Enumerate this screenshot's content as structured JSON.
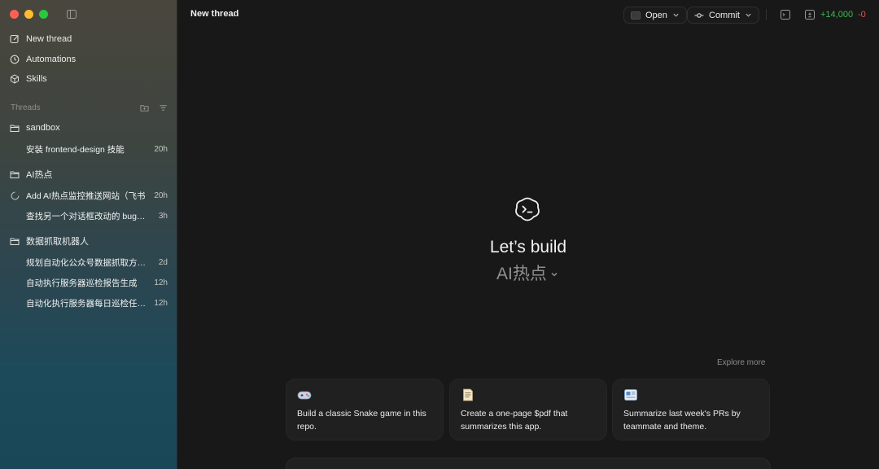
{
  "sidebar": {
    "nav": [
      {
        "label": "New thread",
        "icon": "edit-icon"
      },
      {
        "label": "Automations",
        "icon": "clock-icon"
      },
      {
        "label": "Skills",
        "icon": "cube-icon"
      }
    ],
    "threads_label": "Threads",
    "groups": [
      {
        "folder": "sandbox",
        "threads": [
          {
            "title": "安装 frontend-design 技能",
            "time": "20h"
          }
        ]
      },
      {
        "folder": "AI热点",
        "threads": [
          {
            "title": "Add AI热点监控推送网站（飞书",
            "time": "20h"
          },
          {
            "title": "查找另一个对话框改动的 bug…",
            "time": "3h"
          }
        ]
      },
      {
        "folder": "数据抓取机器人",
        "threads": [
          {
            "title": "规划自动化公众号数据抓取方…",
            "time": "2d"
          },
          {
            "title": "自动执行服务器巡检报告生成",
            "time": "12h"
          },
          {
            "title": "自动化执行服务器每日巡检任…",
            "time": "12h"
          }
        ]
      }
    ]
  },
  "header": {
    "title": "New thread",
    "open_label": "Open",
    "commit_label": "Commit",
    "diff_added": "+14,000",
    "diff_removed": "-0"
  },
  "hero": {
    "title": "Let’s build",
    "project": "AI热点"
  },
  "explore_more": "Explore more",
  "suggestions": [
    {
      "icon": "game-controller-icon",
      "text": "Build a classic Snake game in this repo."
    },
    {
      "icon": "document-icon",
      "text": "Create a one-page $pdf that summarizes this app."
    },
    {
      "icon": "newspaper-icon",
      "text": "Summarize last week's PRs by teammate and theme."
    }
  ],
  "colors": {
    "added": "#3fb950",
    "removed": "#e5534b",
    "background": "#181818"
  }
}
